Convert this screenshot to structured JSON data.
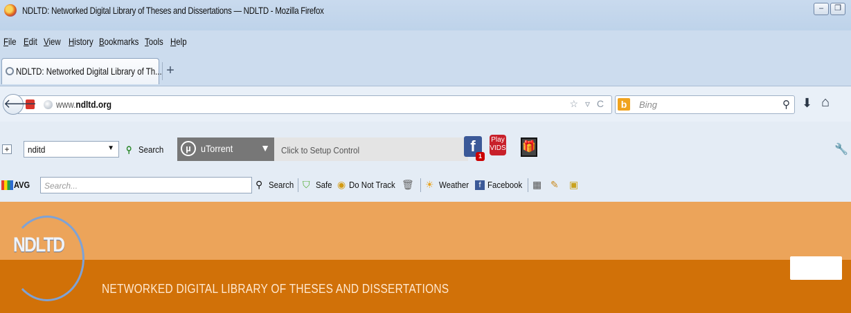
{
  "window": {
    "title": "NDLTD: Networked Digital Library of Theses and Dissertations — NDLTD - Mozilla Firefox",
    "minimize_glyph": "–",
    "restore_glyph": "❐"
  },
  "menubar": {
    "items": [
      "File",
      "Edit",
      "View",
      "History",
      "Bookmarks",
      "Tools",
      "Help"
    ]
  },
  "tabs": {
    "active_label": "NDLTD: Networked Digital Library of Th...",
    "new_tab_glyph": "+"
  },
  "navbar": {
    "back_glyph": "🡐",
    "url_prefix": "www.",
    "url_domain": "ndltd.org",
    "url_icons": "☆ ▿ C",
    "search_engine_letter": "b",
    "search_placeholder": "Bing",
    "search_glyph": "⚲",
    "download_glyph": "⬇",
    "home_glyph": "⌂"
  },
  "toolbar1": {
    "plus_glyph": "+",
    "combo_value": "nditd",
    "search_label": "Search",
    "utorrent_label": "uTorrent",
    "utorrent_logo": "µ",
    "setup_label": "Click to Setup Control",
    "fb_letter": "f",
    "fb_badge": "1",
    "play_label": "Play VIDS",
    "gift_glyph": "🎁",
    "wrench_glyph": "🔧"
  },
  "toolbar2": {
    "avg_label": "AVG",
    "search_placeholder": "Search...",
    "search_label": "Search",
    "safe_label": "Safe",
    "do_not_track_label": "Do Not Track",
    "weather_label": "Weather",
    "facebook_label": "Facebook"
  },
  "page": {
    "logo_text": "NDLTD",
    "tagline": "NETWORKED DIGITAL LIBRARY OF THESES AND DISSERTATIONS"
  },
  "colors": {
    "page_top": "#eca45a",
    "page_band": "#d17108",
    "logo_blue": "#7ea2d6"
  }
}
